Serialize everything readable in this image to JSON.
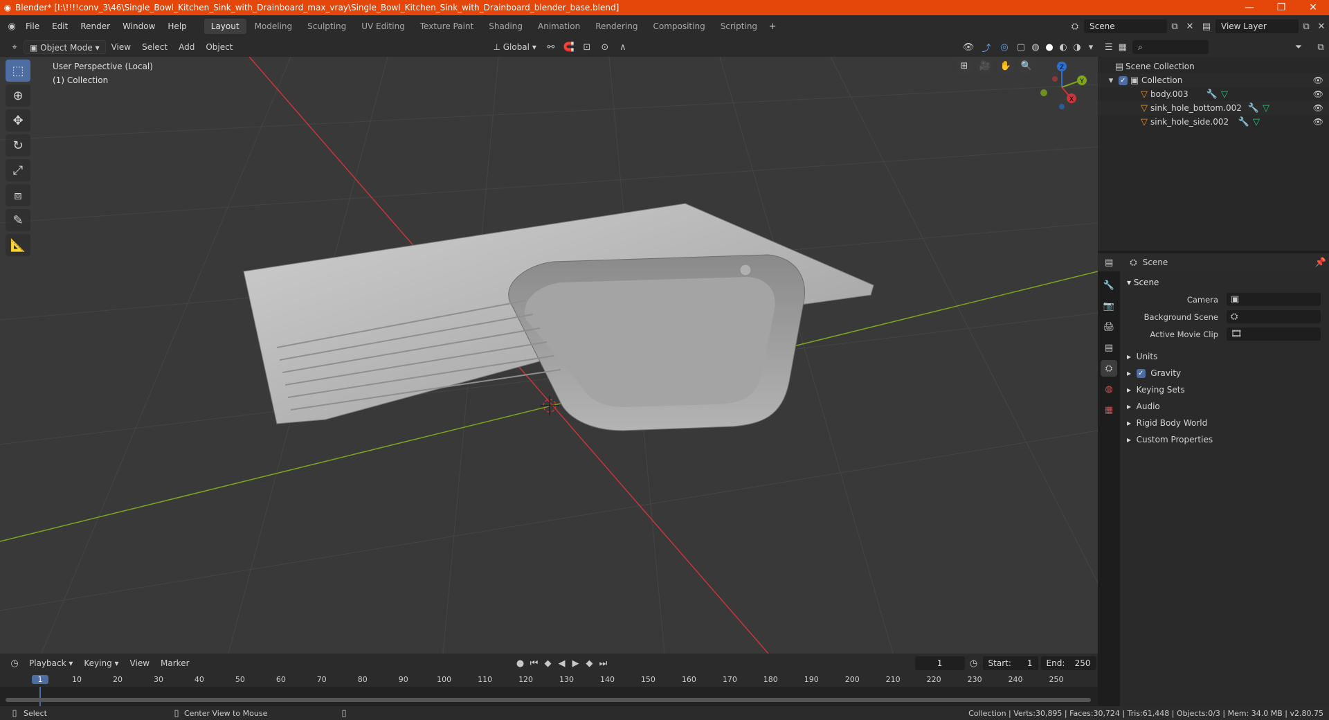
{
  "window": {
    "title": "Blender* [I:\\!!!!conv_3\\46\\Single_Bowl_Kitchen_Sink_with_Drainboard_max_vray\\Single_Bowl_Kitchen_Sink_with_Drainboard_blender_base.blend]",
    "minimize": "—",
    "maximize": "❐",
    "close": "✕"
  },
  "menu": [
    "File",
    "Edit",
    "Render",
    "Window",
    "Help"
  ],
  "workspaces": [
    "Layout",
    "Modeling",
    "Sculpting",
    "UV Editing",
    "Texture Paint",
    "Shading",
    "Animation",
    "Rendering",
    "Compositing",
    "Scripting"
  ],
  "active_workspace": "Layout",
  "scene_selector": "Scene",
  "view_layer": "View Layer",
  "viewport_header": {
    "mode": "Object Mode",
    "menus": [
      "View",
      "Select",
      "Add",
      "Object"
    ],
    "transform_orientation": "Global"
  },
  "viewport": {
    "perspective": "User Perspective (Local)",
    "collection": "(1) Collection",
    "gizmo_axes": {
      "z": "Z",
      "y": "Y",
      "x": "X"
    }
  },
  "outliner": {
    "root": "Scene Collection",
    "collection": "Collection",
    "objects": [
      "body.003",
      "sink_hole_bottom.002",
      "sink_hole_side.002"
    ]
  },
  "properties": {
    "header_title": "Scene",
    "panel_title": "Scene",
    "fields": [
      {
        "label": "Camera",
        "value": ""
      },
      {
        "label": "Background Scene",
        "value": ""
      },
      {
        "label": "Active Movie Clip",
        "value": ""
      }
    ],
    "subpanels": [
      "Units",
      "Gravity",
      "Keying Sets",
      "Audio",
      "Rigid Body World",
      "Custom Properties"
    ]
  },
  "timeline": {
    "menus": [
      "Playback",
      "Keying",
      "View",
      "Marker"
    ],
    "current_frame": "1",
    "start_label": "Start:",
    "start": "1",
    "end_label": "End:",
    "end": "250",
    "ruler": [
      "1",
      "10",
      "20",
      "30",
      "40",
      "50",
      "60",
      "70",
      "80",
      "90",
      "100",
      "110",
      "120",
      "130",
      "140",
      "150",
      "160",
      "170",
      "180",
      "190",
      "200",
      "210",
      "220",
      "230",
      "240",
      "250"
    ]
  },
  "statusbar": {
    "left_action": "Select",
    "middle_action": "Center View to Mouse",
    "stats": "Collection | Verts:30,895 | Faces:30,724 | Tris:61,448 | Objects:0/3 | Mem: 34.0 MB | v2.80.75"
  },
  "colors": {
    "titlebar": "#e5460a",
    "accent_blue": "#4d6da3",
    "x_axis": "#c8353c",
    "y_axis": "#7fa51e",
    "z_axis": "#2f6fd0",
    "object_icon": "#e88d2a"
  }
}
